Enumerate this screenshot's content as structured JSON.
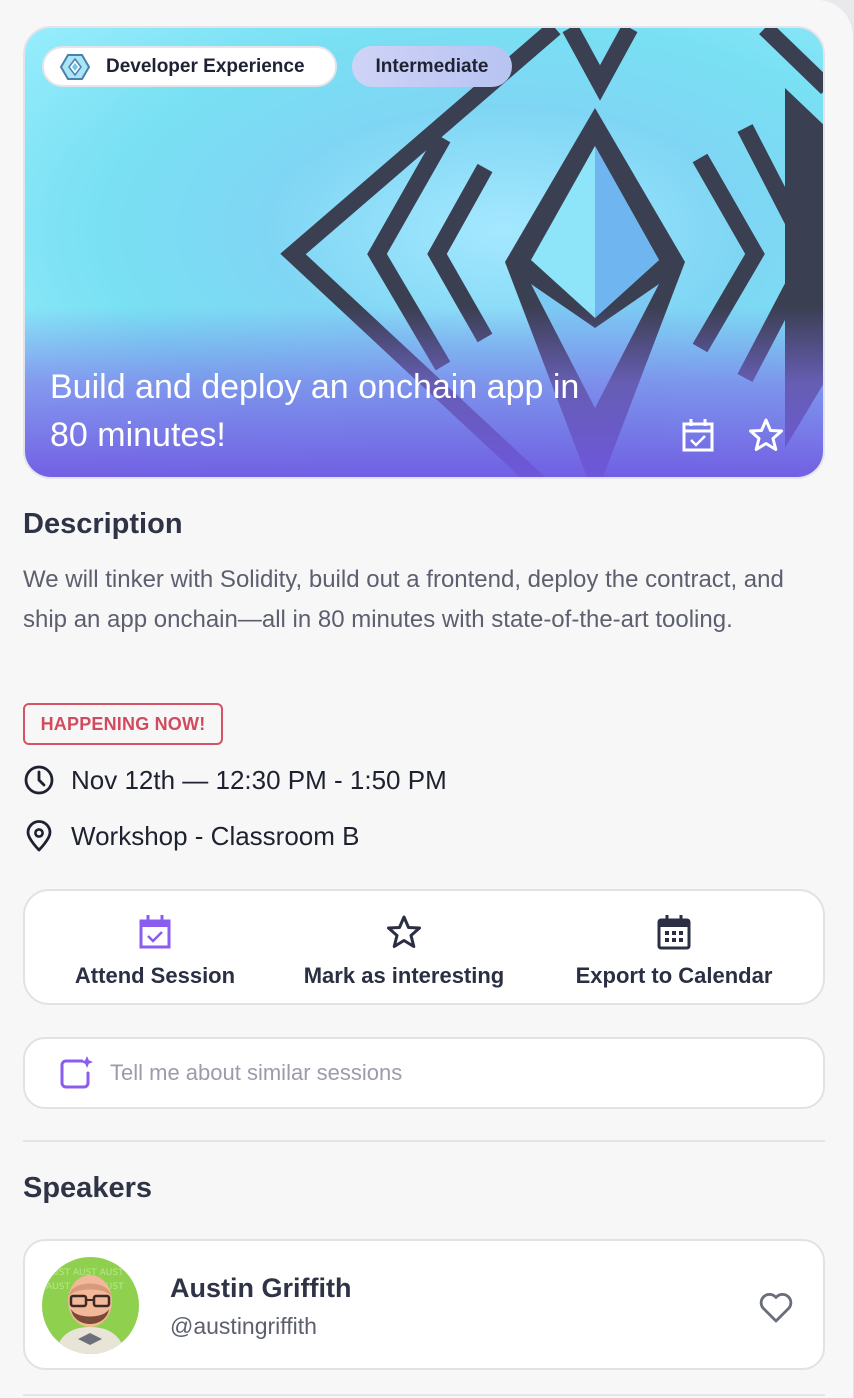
{
  "hero": {
    "track_label": "Developer Experience",
    "level_label": "Intermediate",
    "title": "Build and deploy an onchain app in 80 minutes!",
    "icons": [
      "calendar-check-icon",
      "star-icon"
    ]
  },
  "description": {
    "heading": "Description",
    "text": "We will tinker with Solidity, build out a frontend, deploy the contract, and ship an app onchain—all in 80 minutes with state-of-the-art tooling."
  },
  "status": {
    "label": "HAPPENING NOW!",
    "color": "#d14a5d"
  },
  "schedule": {
    "datetime": "Nov 12th — 12:30 PM - 1:50 PM",
    "icon": "clock-icon"
  },
  "location": {
    "venue": "Workshop - Classroom B",
    "icon": "map-pin-icon"
  },
  "actions": [
    {
      "label": "Attend Session",
      "icon": "calendar-check-icon",
      "color": "#8a5cf0"
    },
    {
      "label": "Mark as interesting",
      "icon": "star-icon",
      "color": "#2b2f43"
    },
    {
      "label": "Export to Calendar",
      "icon": "calendar-grid-icon",
      "color": "#2b2f43"
    }
  ],
  "assistant": {
    "placeholder": "Tell me about similar sessions",
    "icon": "ai-sparkle-icon"
  },
  "speakers": {
    "heading": "Speakers",
    "items": [
      {
        "name": "Austin Griffith",
        "handle": "@austingriffith",
        "icon": "heart-icon"
      }
    ]
  },
  "colors": {
    "accent": "#8a5cf0",
    "hero_gradient_bottom": "#7058e2",
    "hero_sky": "#7fd6f4"
  }
}
